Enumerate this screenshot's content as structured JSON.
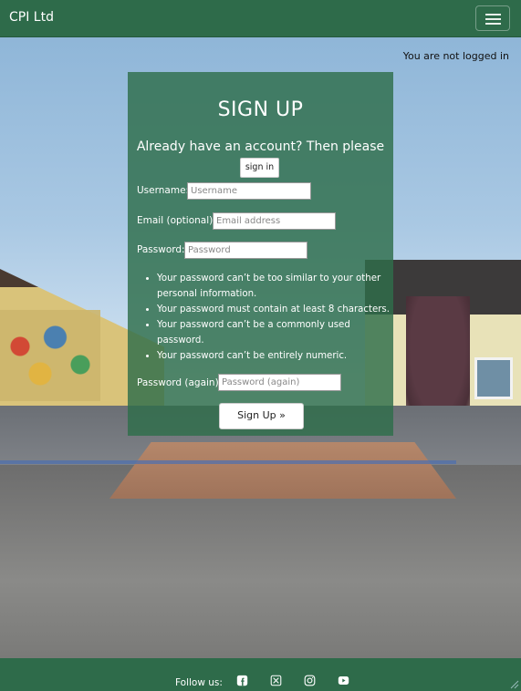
{
  "navbar": {
    "brand": "CPI Ltd",
    "menu_icon": "hamburger-menu-icon"
  },
  "status": {
    "login_text": "You are not logged in"
  },
  "signup": {
    "title": "SIGN UP",
    "prompt": "Already have an account? Then please",
    "signin_label": "sign in",
    "username_label": "Username:",
    "username_placeholder": "Username",
    "email_label": "Email (optional):",
    "email_placeholder": "Email address",
    "password_label": "Password:",
    "password_placeholder": "Password",
    "password_rules": [
      "Your password can’t be too similar to your other personal information.",
      "Your password must contain at least 8 characters.",
      "Your password can’t be a commonly used password.",
      "Your password can’t be entirely numeric."
    ],
    "password2_label": "Password (again):",
    "password2_placeholder": "Password (again)",
    "submit_label": "Sign Up »"
  },
  "footer": {
    "follow_label": "Follow us:",
    "social": [
      "facebook-icon",
      "x-twitter-icon",
      "instagram-icon",
      "youtube-icon"
    ]
  },
  "colors": {
    "brand_green": "#2e6b4a",
    "panel_green": "#2e6e4b"
  }
}
